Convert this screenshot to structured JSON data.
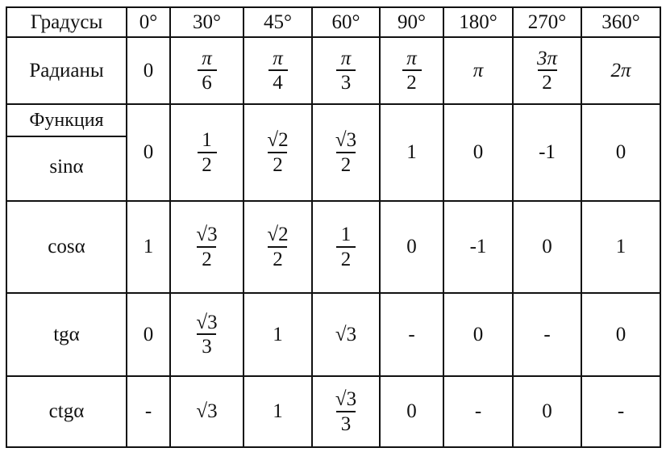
{
  "header": {
    "label": "Градусы",
    "degrees": [
      "0°",
      "30°",
      "45°",
      "60°",
      "90°",
      "180°",
      "270°",
      "360°"
    ]
  },
  "radians": {
    "label": "Радианы",
    "values": [
      {
        "text": "0"
      },
      {
        "num": "π",
        "den": "6"
      },
      {
        "num": "π",
        "den": "4"
      },
      {
        "num": "π",
        "den": "3"
      },
      {
        "num": "π",
        "den": "2"
      },
      {
        "text": "π"
      },
      {
        "num": "3π",
        "den": "2"
      },
      {
        "text": "2π"
      }
    ]
  },
  "function_label": "Функция",
  "rows": [
    {
      "label": "sinα",
      "values": [
        {
          "text": "0"
        },
        {
          "num": "1",
          "den": "2"
        },
        {
          "num": "√2",
          "den": "2"
        },
        {
          "num": "√3",
          "den": "2"
        },
        {
          "text": "1"
        },
        {
          "text": "0"
        },
        {
          "text": "-1"
        },
        {
          "text": "0"
        }
      ]
    },
    {
      "label": "cosα",
      "values": [
        {
          "text": "1"
        },
        {
          "num": "√3",
          "den": "2"
        },
        {
          "num": "√2",
          "den": "2"
        },
        {
          "num": "1",
          "den": "2"
        },
        {
          "text": "0"
        },
        {
          "text": "-1"
        },
        {
          "text": "0"
        },
        {
          "text": "1"
        }
      ]
    },
    {
      "label": "tgα",
      "values": [
        {
          "text": "0"
        },
        {
          "num": "√3",
          "den": "3"
        },
        {
          "text": "1"
        },
        {
          "text": "√3"
        },
        {
          "text": "-"
        },
        {
          "text": "0"
        },
        {
          "text": "-"
        },
        {
          "text": "0"
        }
      ]
    },
    {
      "label": "ctgα",
      "values": [
        {
          "text": "-"
        },
        {
          "text": "√3"
        },
        {
          "text": "1"
        },
        {
          "num": "√3",
          "den": "3"
        },
        {
          "text": "0"
        },
        {
          "text": "-"
        },
        {
          "text": "0"
        },
        {
          "text": "-"
        }
      ]
    }
  ]
}
